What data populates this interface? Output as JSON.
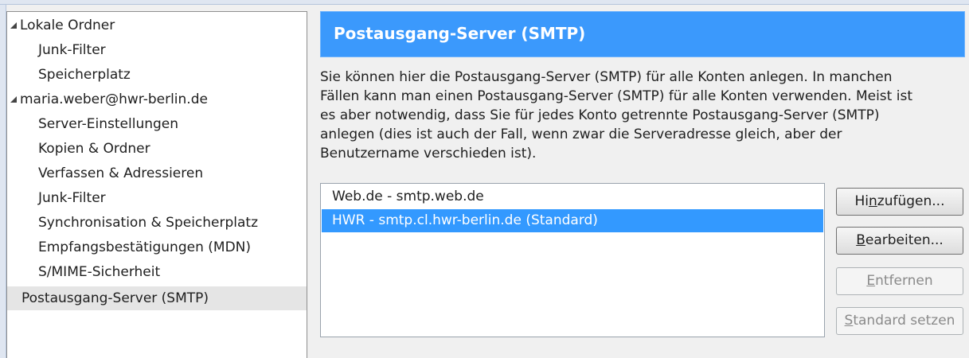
{
  "tree": {
    "items": [
      {
        "label": "Lokale Ordner",
        "expanded": true
      },
      {
        "label": "Junk-Filter"
      },
      {
        "label": "Speicherplatz"
      },
      {
        "label": "maria.weber@hwr-berlin.de",
        "expanded": true
      },
      {
        "label": "Server-Einstellungen"
      },
      {
        "label": "Kopien & Ordner"
      },
      {
        "label": "Verfassen & Adressieren"
      },
      {
        "label": "Junk-Filter"
      },
      {
        "label": "Synchronisation & Speicherplatz"
      },
      {
        "label": "Empfangsbestätigungen (MDN)"
      },
      {
        "label": "S/MIME-Sicherheit"
      },
      {
        "label": "Postausgang-Server (SMTP)",
        "selected": true
      }
    ]
  },
  "panel": {
    "title": "Postausgang-Server (SMTP)",
    "description_lines": [
      "Sie können hier die Postausgang-Server (SMTP) für alle Konten anlegen. In manchen",
      "Fällen kann man einen Postausgang-Server (SMTP) für alle Konten verwenden. Meist ist",
      "es aber notwendig, dass Sie für jedes Konto getrennte Postausgang-Server (SMTP)",
      "anlegen (dies ist auch der Fall, wenn zwar die Serveradresse gleich, aber der",
      "Benutzername verschieden ist)."
    ]
  },
  "servers": [
    {
      "label": "Web.de - smtp.web.de",
      "selected": false
    },
    {
      "label": "HWR - smtp.cl.hwr-berlin.de (Standard)",
      "selected": true
    }
  ],
  "buttons": {
    "add": {
      "pre": "Hi",
      "key": "n",
      "post": "zufügen...",
      "enabled": true
    },
    "edit": {
      "pre": "",
      "key": "B",
      "post": "earbeiten...",
      "enabled": true
    },
    "remove": {
      "pre": "",
      "key": "E",
      "post": "ntfernen",
      "enabled": false
    },
    "default": {
      "pre": "",
      "key": "S",
      "post": "tandard setzen",
      "enabled": false
    }
  },
  "colors": {
    "header": "#3b99fc",
    "selection": "#3399ff",
    "tree_selection": "#e5e5e5"
  }
}
